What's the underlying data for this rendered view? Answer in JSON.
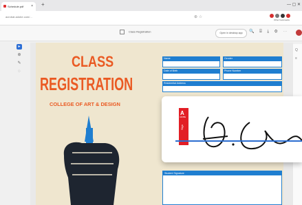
{
  "browser": {
    "tab_title": "Schedule.pdf",
    "tab_close": "×",
    "new_tab": "+",
    "window_controls": "— ▢ ✕",
    "url": "acrobat.adobe.com/...",
    "extension_label": "Other bookmarks"
  },
  "toolbar": {
    "doc_name": "Class Registration",
    "open_button": "Open in desktop app",
    "icons": "🔍 ⌸ ⤓ ⚙ ⋯"
  },
  "left_tools": [
    "select-cursor",
    "zoom",
    "draw",
    "comment"
  ],
  "right_tools": [
    "Q",
    "≡",
    "○",
    "⊕"
  ],
  "document": {
    "title_line1": "CLASS",
    "title_line2": "REGISTRATION",
    "subtitle": "COLLEGE OF ART & DESIGN",
    "fields": {
      "name": "Name",
      "gender": "Gender",
      "dob": "Date of Birth",
      "phone": "Phone Number",
      "address": "Residential Address",
      "student_signature": "Student Signature"
    }
  },
  "sign_card": {
    "badge_letter": "A",
    "badge_label": "ADOBE",
    "badge_action": "Sign"
  },
  "colors": {
    "accent": "#ea5a23",
    "form_blue": "#1f7ed0",
    "adobe_red": "#e21e25",
    "page_bg": "#efe6cf"
  }
}
